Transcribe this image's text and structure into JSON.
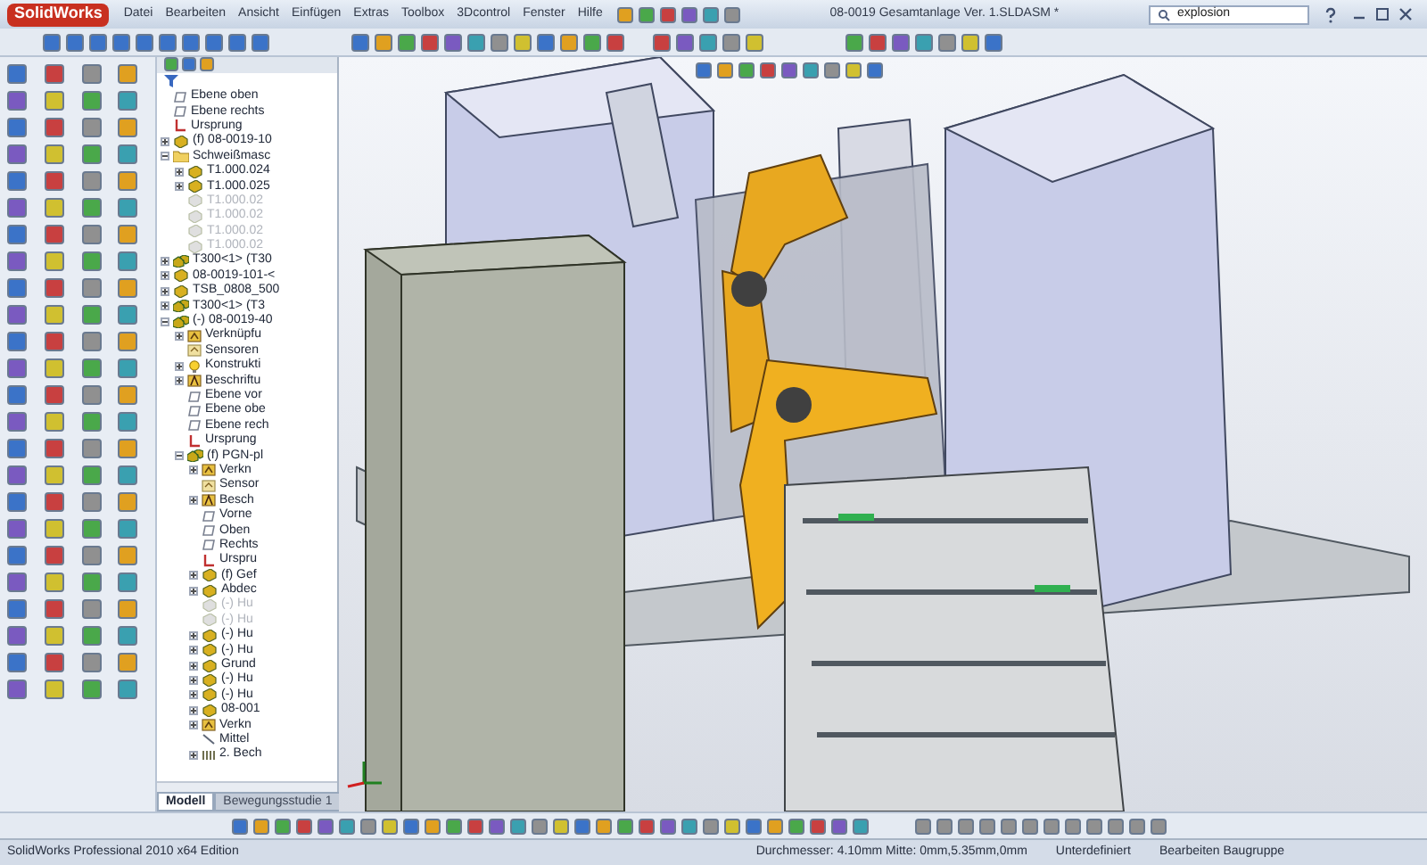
{
  "window": {
    "logo": "SolidWorks",
    "menu": [
      "Datei",
      "Bearbeiten",
      "Ansicht",
      "Einfügen",
      "Extras",
      "Toolbox",
      "3Dcontrol",
      "Fenster",
      "Hilfe"
    ],
    "title": "08-0019 Gesamtanlage Ver. 1.SLDASM *",
    "search": {
      "value": "explosion"
    }
  },
  "tree": {
    "items": [
      {
        "label": "Ebene oben",
        "kind": "plane",
        "suppressed": false
      },
      {
        "label": "Ebene rechts",
        "kind": "plane",
        "suppressed": false
      },
      {
        "label": "Ursprung",
        "kind": "origin",
        "suppressed": false
      },
      {
        "label": "(f) 08-0019-10",
        "kind": "part",
        "suppressed": false,
        "expanded": false
      },
      {
        "label": "Schweißmasc",
        "kind": "folder",
        "suppressed": false,
        "expanded": true,
        "children": [
          {
            "label": "T1.000.024",
            "kind": "part",
            "suppressed": false,
            "expanded": false
          },
          {
            "label": "T1.000.025",
            "kind": "part",
            "suppressed": false,
            "expanded": false
          },
          {
            "label": "T1.000.02",
            "kind": "part",
            "suppressed": true
          },
          {
            "label": "T1.000.02",
            "kind": "part",
            "suppressed": true
          },
          {
            "label": "T1.000.02",
            "kind": "part",
            "suppressed": true
          },
          {
            "label": "T1.000.02",
            "kind": "part",
            "suppressed": true
          }
        ]
      },
      {
        "label": "T300<1> (T30",
        "kind": "assembly",
        "suppressed": false,
        "expanded": false
      },
      {
        "label": "08-0019-101-<",
        "kind": "part",
        "suppressed": false,
        "expanded": false
      },
      {
        "label": "TSB_0808_500",
        "kind": "part",
        "suppressed": false,
        "expanded": false
      },
      {
        "label": "T300<1> (T3",
        "kind": "assembly",
        "suppressed": false,
        "expanded": false
      },
      {
        "label": "(-) 08-0019-40",
        "kind": "assembly",
        "suppressed": false,
        "expanded": true,
        "children": [
          {
            "label": "Verknüpfu",
            "kind": "mates",
            "suppressed": false,
            "expanded": false
          },
          {
            "label": "Sensoren",
            "kind": "sensors",
            "suppressed": false
          },
          {
            "label": "Konstrukti",
            "kind": "annotations",
            "suppressed": false,
            "expanded": false
          },
          {
            "label": "Beschriftu",
            "kind": "notes",
            "suppressed": false,
            "expanded": false
          },
          {
            "label": "Ebene vor",
            "kind": "plane",
            "suppressed": false
          },
          {
            "label": "Ebene obe",
            "kind": "plane",
            "suppressed": false
          },
          {
            "label": "Ebene rech",
            "kind": "plane",
            "suppressed": false
          },
          {
            "label": "Ursprung",
            "kind": "origin",
            "suppressed": false
          },
          {
            "label": "(f) PGN-pl",
            "kind": "assembly",
            "suppressed": false,
            "expanded": true,
            "children": [
              {
                "label": "Verkn",
                "kind": "mates",
                "suppressed": false,
                "expanded": false
              },
              {
                "label": "Sensor",
                "kind": "sensors",
                "suppressed": false
              },
              {
                "label": "Besch",
                "kind": "notes",
                "suppressed": false,
                "expanded": false
              },
              {
                "label": "Vorne",
                "kind": "plane",
                "suppressed": false
              },
              {
                "label": "Oben",
                "kind": "plane",
                "suppressed": false
              },
              {
                "label": "Rechts",
                "kind": "plane",
                "suppressed": false
              },
              {
                "label": "Urspru",
                "kind": "origin",
                "suppressed": false
              },
              {
                "label": "(f) Gef",
                "kind": "part",
                "suppressed": false,
                "expanded": false
              },
              {
                "label": "Abdec",
                "kind": "part",
                "suppressed": false,
                "expanded": false
              },
              {
                "label": "(-) Hu",
                "kind": "part",
                "suppressed": true
              },
              {
                "label": "(-) Hu",
                "kind": "part",
                "suppressed": true
              },
              {
                "label": "(-) Hu",
                "kind": "part",
                "suppressed": false,
                "expanded": false
              },
              {
                "label": "(-) Hu",
                "kind": "part",
                "suppressed": false,
                "expanded": false
              },
              {
                "label": "Grund",
                "kind": "part",
                "suppressed": false,
                "expanded": false
              },
              {
                "label": "(-) Hu",
                "kind": "part",
                "suppressed": false,
                "expanded": false
              },
              {
                "label": "(-) Hu",
                "kind": "part",
                "suppressed": false,
                "expanded": false
              },
              {
                "label": "08-001",
                "kind": "part",
                "suppressed": false,
                "expanded": false
              },
              {
                "label": "Verkn",
                "kind": "mates",
                "suppressed": false,
                "expanded": false
              },
              {
                "label": "Mittel",
                "kind": "line",
                "suppressed": false
              },
              {
                "label": "2. Bech",
                "kind": "pattern",
                "suppressed": false,
                "expanded": false
              }
            ]
          }
        ]
      }
    ]
  },
  "bottom_tabs": [
    {
      "label": "Modell",
      "selected": true
    },
    {
      "label": "Bewegungsstudie 1",
      "selected": false
    }
  ],
  "status_bar": {
    "edition": "SolidWorks Professional 2010 x64 Edition",
    "measure": "Durchmesser: 4.10mm Mitte: 0mm,5.35mm,0mm",
    "state": "Unterdefiniert",
    "mode": "Bearbeiten Baugruppe"
  }
}
